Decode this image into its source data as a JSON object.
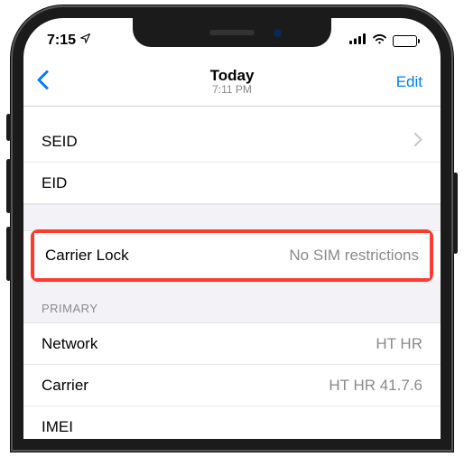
{
  "status": {
    "time": "7:15",
    "loc_icon": "location-arrow"
  },
  "nav": {
    "title": "Today",
    "subtitle": "7:11 PM",
    "edit": "Edit"
  },
  "rows": {
    "seid": {
      "label": "SEID"
    },
    "eid": {
      "label": "EID"
    },
    "carrier_lock": {
      "label": "Carrier Lock",
      "value": "No SIM restrictions"
    }
  },
  "section_primary": {
    "header": "PRIMARY",
    "network": {
      "label": "Network",
      "value": "HT HR"
    },
    "carrier": {
      "label": "Carrier",
      "value": "HT HR 41.7.6"
    },
    "imei": {
      "label": "IMEI"
    }
  }
}
